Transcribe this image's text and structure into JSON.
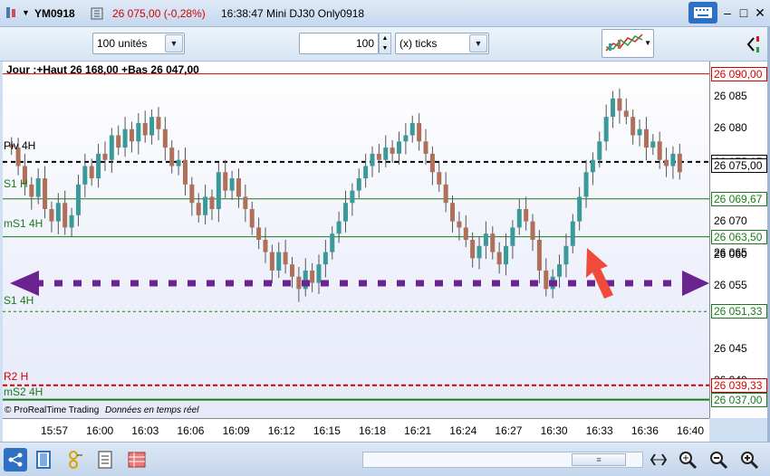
{
  "titlebar": {
    "symbol": "YM0918",
    "price_change": "26 075,00 (-0,28%)",
    "instrument": "16:38:47 Mini DJ30 Only0918",
    "min_label": "–",
    "max_label": "□",
    "close_label": "✕"
  },
  "toolbar": {
    "units_value": "100 unités",
    "ticks_count": "100",
    "ticks_mode": "(x) ticks"
  },
  "chart": {
    "header": "Jour :+Haut 26 168,00 +Bas 26 047,00",
    "copyright": "© ProRealTime Trading",
    "realtime": "Données en temps réel",
    "level_labels": [
      "Piv 4H",
      "S1 H",
      "mS1 4H",
      "S1 4H",
      "R2 H",
      "mS2 4H"
    ]
  },
  "price_axis": {
    "tick_labels": [
      "26 085",
      "26 080",
      "26 070",
      "26 065",
      "26 060",
      "26 055",
      "26 045",
      "26 040"
    ],
    "boxes": [
      {
        "text": "26 090,00",
        "color": "#d40000"
      },
      {
        "text": "26 075,67",
        "color": "#000000"
      },
      {
        "text": "26 075,00",
        "color": "#000000"
      },
      {
        "text": "26 069,67",
        "color": "#1a7a1a"
      },
      {
        "text": "26 063,50",
        "color": "#1a7a1a"
      },
      {
        "text": "26 051,33",
        "color": "#1a7a1a"
      },
      {
        "text": "26 039,33",
        "color": "#d40000"
      },
      {
        "text": "26 037,00",
        "color": "#1a7a1a"
      }
    ]
  },
  "time_axis": {
    "labels": [
      "15:57",
      "16:00",
      "16:03",
      "16:06",
      "16:09",
      "16:12",
      "16:15",
      "16:18",
      "16:21",
      "16:24",
      "16:27",
      "16:30",
      "16:33",
      "16:36",
      "16:40"
    ]
  },
  "colors": {
    "up": "#3a9a9a",
    "down": "#b06f58",
    "support": "#1a7a1a",
    "resistance": "#d40000",
    "annotation": "#6a2390",
    "arrow": "#f04a3a"
  },
  "chart_data": {
    "type": "candlestick",
    "price_range": [
      26034,
      26092
    ],
    "closes": [
      26078,
      26075,
      26072,
      26070,
      26073,
      26068,
      26066,
      26069,
      26065,
      26067,
      26072,
      26075,
      26073,
      26077,
      26076,
      26080,
      26078,
      26081,
      26079,
      26082,
      26080,
      26083,
      26081,
      26078,
      26075,
      26076,
      26072,
      26069,
      26067,
      26070,
      26068,
      26074,
      26071,
      26073,
      26070,
      26068,
      26065,
      26063,
      26061,
      26058,
      26061,
      26059,
      26057,
      26055,
      26058,
      26056,
      26059,
      26061,
      26064,
      26066,
      26069,
      26071,
      26073,
      26075,
      26077,
      26076,
      26078,
      26077,
      26079,
      26080,
      26082,
      26079,
      26077,
      26074,
      26072,
      26069,
      26066,
      26065,
      26063,
      26060,
      26062,
      26064,
      26061,
      26059,
      26062,
      26065,
      26068,
      26066,
      26063,
      26058,
      26055,
      26057,
      26059,
      26062,
      26066,
      26070,
      26074,
      26076,
      26079,
      26083,
      26086,
      26084,
      26083,
      26080,
      26081,
      26078,
      26079,
      26076,
      26075,
      26077,
      26074
    ]
  }
}
